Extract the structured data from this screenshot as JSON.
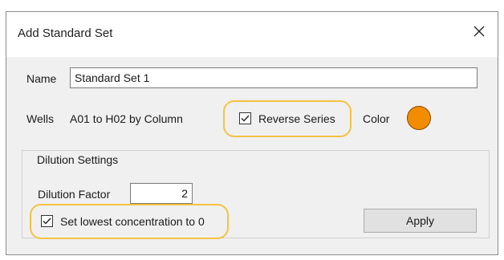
{
  "dialog": {
    "title": "Add Standard Set",
    "close_icon": "close-icon"
  },
  "name_field": {
    "label": "Name",
    "value": "Standard Set 1"
  },
  "wells": {
    "label": "Wells",
    "value": "A01 to H02 by Column"
  },
  "reverse_series": {
    "label": "Reverse Series",
    "checked": true
  },
  "color": {
    "label": "Color",
    "value": "#f28c00"
  },
  "dilution": {
    "group_title": "Dilution Settings",
    "factor_label": "Dilution Factor",
    "factor_value": "2",
    "lowest_zero_label": "Set lowest concentration to 0",
    "lowest_zero_checked": true,
    "apply_label": "Apply"
  },
  "colors": {
    "highlight": "#f5c242",
    "dialog_bg": "#f0f0f0",
    "swatch": "#f28c00"
  }
}
